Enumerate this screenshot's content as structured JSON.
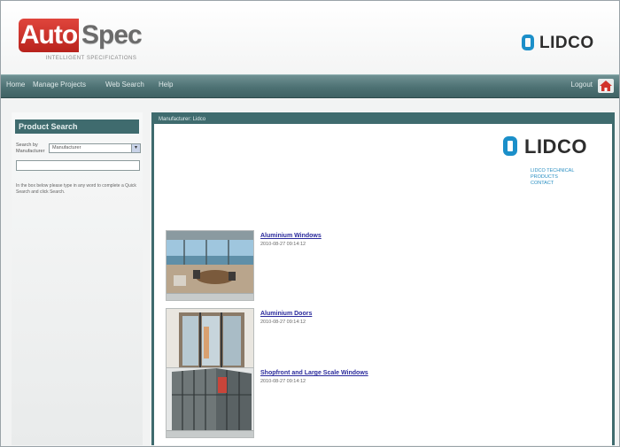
{
  "header": {
    "autospec_auto": "Auto",
    "autospec_spec": "Spec",
    "autospec_tagline": "INTELLIGENT SPECIFICATIONS",
    "brand_logo": "LIDCO"
  },
  "nav": {
    "items": [
      "Home",
      "Manage Projects",
      "Web Search",
      "Help"
    ],
    "user_label": "Logout"
  },
  "sidebar": {
    "title": "Product Search",
    "label": "Search by Manufacturer",
    "select_value": "Manufacturer",
    "input_value": "",
    "help_text": "In the box below please type in any word to complete a Quick Search and click Search."
  },
  "main": {
    "bar_title": "Manufacturer: Lidco",
    "brand_logo": "LIDCO",
    "links": [
      "LIDCO TECHNICAL",
      "PRODUCTS",
      "CONTACT"
    ],
    "products": [
      {
        "title": "Aluminium Windows",
        "date": "2010-08-27 09:14:12"
      },
      {
        "title": "Aluminium Doors",
        "date": "2010-08-27 09:14:12"
      },
      {
        "title": "Shopfront and Large Scale Windows",
        "date": "2010-08-27 09:14:12"
      }
    ]
  },
  "colors": {
    "accent_red": "#c7302a",
    "nav_teal": "#4d7173",
    "panel_teal": "#3f6b6e",
    "lidco_blue": "#1b8fc9",
    "link_blue": "#2a2a9c"
  },
  "icons": {
    "home": "home-icon",
    "lidco_mark": "lidco-mark-icon",
    "dropdown": "chevron-down-icon"
  }
}
